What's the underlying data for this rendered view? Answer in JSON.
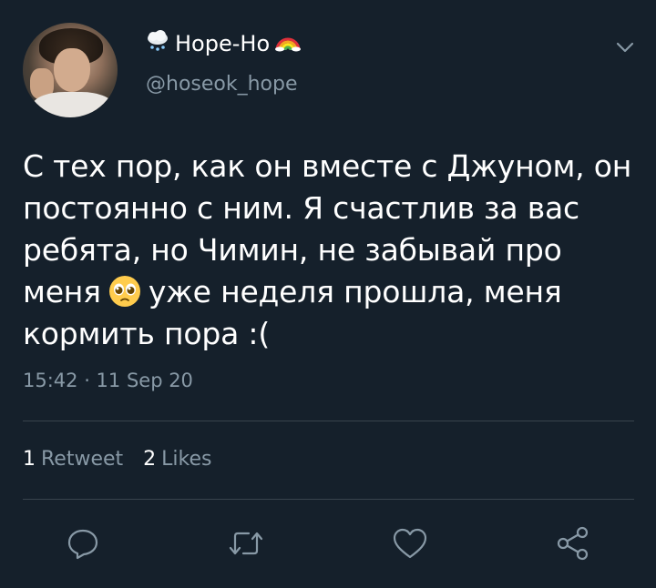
{
  "user": {
    "display_name": "Hope-Ho",
    "name_prefix_icon": "cloud-snow-emoji",
    "name_suffix_icon": "rainbow-emoji",
    "handle": "@hoseok_hope"
  },
  "tweet": {
    "text_part1": "С тех пор, как он вместе с Джуном, он постоянно с ним. Я счастлив за вас ребята, но Чимин, не забывай про меня",
    "inline_icon": "pleading-face-emoji",
    "text_part2": "уже неделя прошла, меня кормить пора :(",
    "timestamp": "15:42 · 11 Sep 20"
  },
  "stats": {
    "retweets_count": "1",
    "retweets_label": "Retweet",
    "likes_count": "2",
    "likes_label": "Likes"
  },
  "actions": [
    "reply-icon",
    "retweet-icon",
    "like-icon",
    "share-icon"
  ],
  "colors": {
    "background": "#15202b",
    "secondary_text": "#8899a6",
    "divider": "#38444d",
    "icon": "#8899a6"
  }
}
